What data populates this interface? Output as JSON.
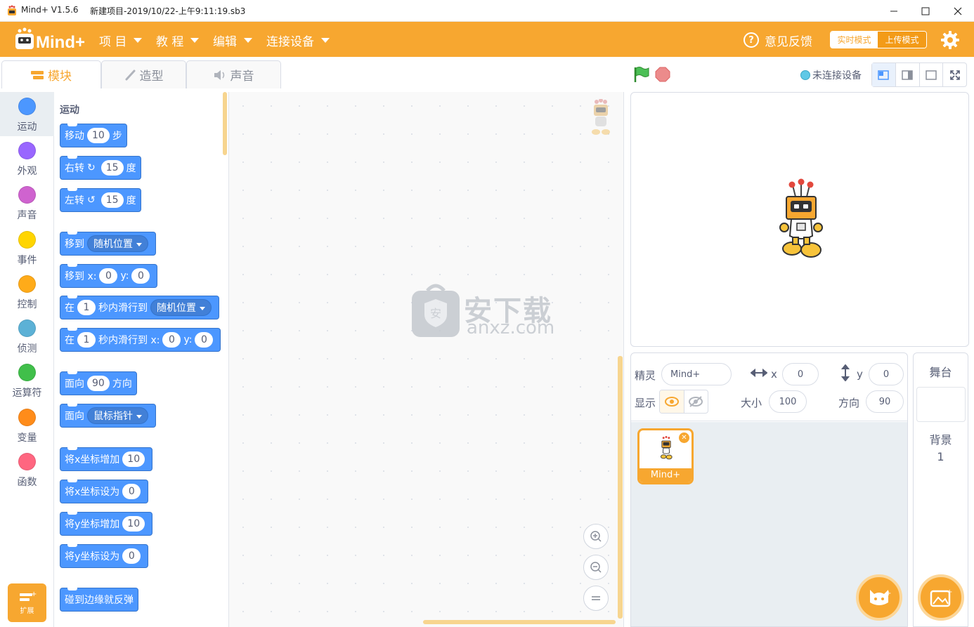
{
  "window": {
    "app_title": "Mind+ V1.5.6",
    "file_title": "新建项目-2019/10/22-上午9:11:19.sb3"
  },
  "menu": {
    "items": [
      {
        "label": "项 目"
      },
      {
        "label": "教 程"
      },
      {
        "label": "编辑"
      },
      {
        "label": "连接设备"
      }
    ],
    "feedback_label": "意见反馈",
    "mode_live": "实时模式",
    "mode_upload": "上传模式",
    "accent_color": "#f7a730"
  },
  "tabs": [
    {
      "label": "模块",
      "icon": "blocks-icon"
    },
    {
      "label": "造型",
      "icon": "brush-icon"
    },
    {
      "label": "声音",
      "icon": "speaker-icon"
    }
  ],
  "categories": [
    {
      "label": "运动",
      "color": "#4c97ff"
    },
    {
      "label": "外观",
      "color": "#9966ff"
    },
    {
      "label": "声音",
      "color": "#cf63cf"
    },
    {
      "label": "事件",
      "color": "#ffd500"
    },
    {
      "label": "控制",
      "color": "#ffab19"
    },
    {
      "label": "侦测",
      "color": "#5cb1d6"
    },
    {
      "label": "运算符",
      "color": "#40bf4a"
    },
    {
      "label": "变量",
      "color": "#ff8c1a"
    },
    {
      "label": "函数",
      "color": "#ff6680"
    }
  ],
  "extension_label": "扩展",
  "palette": {
    "section_title": "运动",
    "blocks": {
      "move": {
        "text": "移动",
        "value": "10",
        "suffix": "步"
      },
      "turn_right": {
        "text": "右转",
        "value": "15",
        "suffix": "度"
      },
      "turn_left": {
        "text": "左转",
        "value": "15",
        "suffix": "度"
      },
      "goto": {
        "text": "移到",
        "dropdown": "随机位置"
      },
      "goto_xy": {
        "text": "移到 x:",
        "x": "0",
        "ylabel": "y:",
        "y": "0"
      },
      "glide": {
        "prefix": "在",
        "secs": "1",
        "text": "秒内滑行到",
        "dropdown": "随机位置"
      },
      "glide_xy": {
        "prefix": "在",
        "secs": "1",
        "text": "秒内滑行到 x:",
        "x": "0",
        "ylabel": "y:",
        "y": "0"
      },
      "point_dir": {
        "text": "面向",
        "value": "90",
        "suffix": "方向"
      },
      "point_towards": {
        "text": "面向",
        "dropdown": "鼠标指针"
      },
      "change_x": {
        "text": "将x坐标增加",
        "value": "10"
      },
      "set_x": {
        "text": "将x坐标设为",
        "value": "0"
      },
      "change_y": {
        "text": "将y坐标增加",
        "value": "10"
      },
      "set_y": {
        "text": "将y坐标设为",
        "value": "0"
      },
      "bounce": {
        "text": "碰到边缘就反弹"
      }
    }
  },
  "watermark": {
    "text": "安下载",
    "url": "anxz.com"
  },
  "stage_header": {
    "connection_status": "未连接设备"
  },
  "sprite_info": {
    "sprite_label": "精灵",
    "sprite_name": "Mind+",
    "x_label": "x",
    "x_value": "0",
    "y_label": "y",
    "y_value": "0",
    "show_label": "显示",
    "size_label": "大小",
    "size_value": "100",
    "direction_label": "方向",
    "direction_value": "90"
  },
  "sprites": [
    {
      "name": "Mind+"
    }
  ],
  "stage_selector": {
    "title": "舞台",
    "backdrop_label": "背景",
    "backdrop_count": "1"
  }
}
